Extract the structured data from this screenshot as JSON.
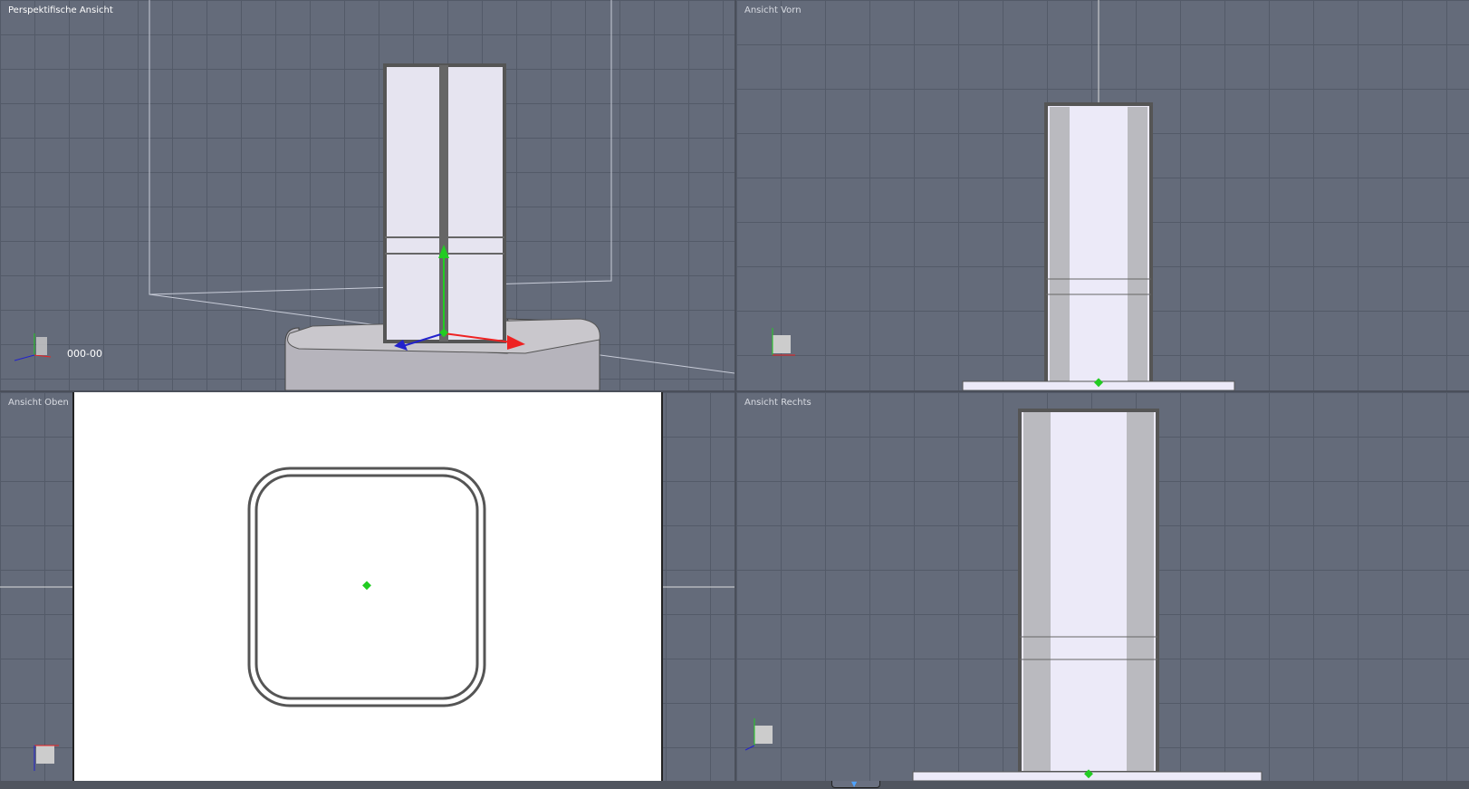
{
  "viewports": {
    "perspective": {
      "label": "Perspektifische Ansicht",
      "coordinate": "000-00"
    },
    "front": {
      "label": "Ansicht Vorn"
    },
    "top": {
      "label": "Ansicht Oben"
    },
    "right": {
      "label": "Ansicht Rechts"
    }
  },
  "axes": {
    "x": "X",
    "y": "Y",
    "z": "Z"
  },
  "colors": {
    "viewport_bg": "#646b7a",
    "grid": "#535a68",
    "object": "#eceaf8",
    "wire": "#555555",
    "pivot": "#22cc22"
  }
}
